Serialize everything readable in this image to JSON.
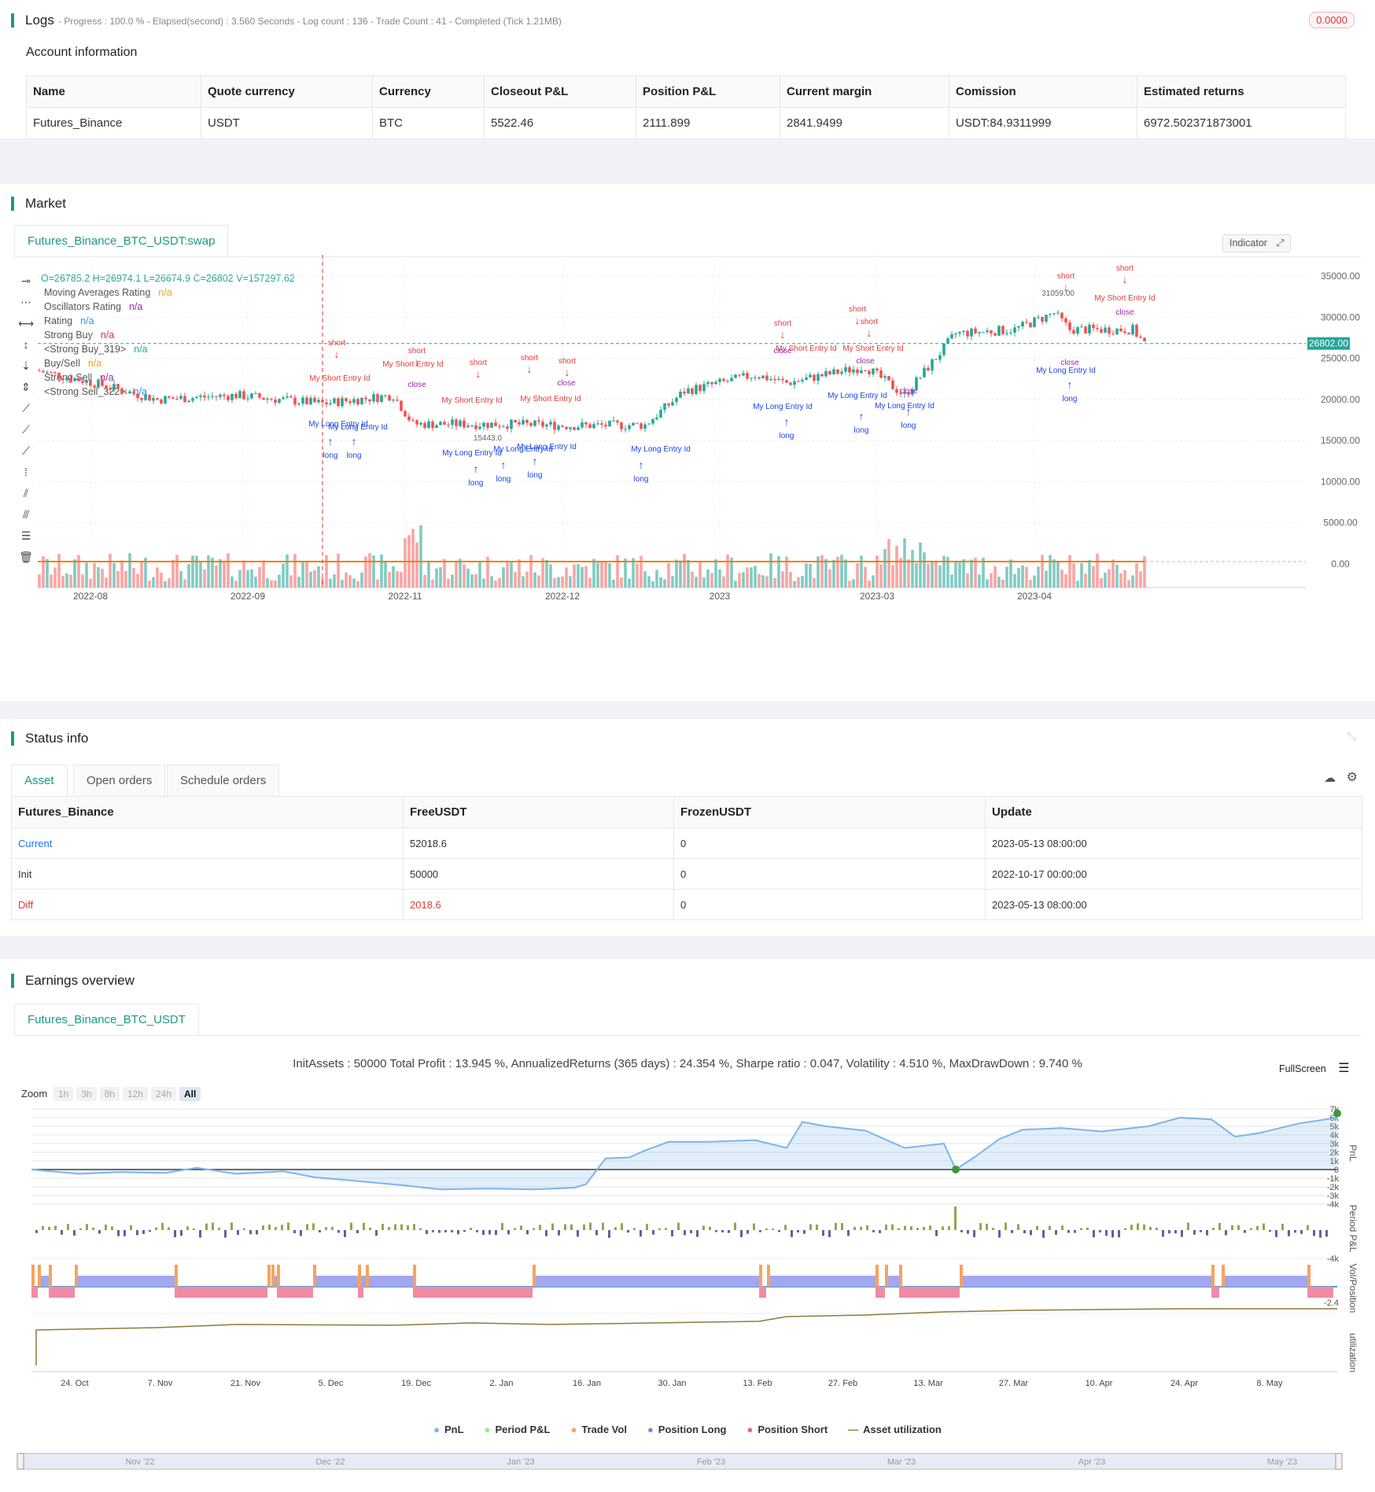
{
  "logs": {
    "title": "Logs",
    "status": "- Progress : 100.0 % - Elapsed(second) : 3.560  Seconds - Log count : 136 - Trade Count : 41 - Completed (Tick 1.21MB)",
    "badge": "0.0000",
    "account_title": "Account information",
    "columns": [
      "Name",
      "Quote currency",
      "Currency",
      "Closeout P&L",
      "Position P&L",
      "Current margin",
      "Comission",
      "Estimated returns"
    ],
    "row": [
      "Futures_Binance",
      "USDT",
      "BTC",
      "5522.46",
      "2111.899",
      "2841.9499",
      "USDT:84.9311999",
      "6972.502371873001"
    ]
  },
  "market": {
    "title": "Market",
    "tab": "Futures_Binance_BTC_USDT:swap",
    "ohlc": "O=26785.2  H=26974.1  L=26674.9  C=26802  V=157297.62",
    "indicator_btn": "Indicator",
    "legend": [
      {
        "label": "Moving Averages Rating",
        "value": "n/a",
        "color": "#f4a21c"
      },
      {
        "label": "Oscillators Rating",
        "value": "n/a",
        "color": "#9c27b0"
      },
      {
        "label": "Rating",
        "value": "n/a",
        "color": "#2196f3"
      },
      {
        "label": "Strong Buy",
        "value": "n/a",
        "color": "#e91e63"
      },
      {
        "label": "<Strong Buy_319>",
        "value": "n/a",
        "color": "#26a69a"
      },
      {
        "label": "Buy/Sell",
        "value": "n/a",
        "color": "#f4a21c"
      },
      {
        "label": "Strong Sell",
        "value": "n/a",
        "color": "#9c27b0"
      },
      {
        "label": "<Strong Sell_322>",
        "value": "n/a",
        "color": "#2196f3"
      }
    ],
    "price_ticks": [
      "35000.00",
      "30000.00",
      "25000.00",
      "20000.00",
      "15000.00",
      "10000.00",
      "5000.00",
      "0.00"
    ],
    "last_price": "26802.00",
    "x_ticks": [
      "2022-08",
      "2022-09",
      "2022-11",
      "2022-12",
      "2023",
      "2023-03",
      "2023-04"
    ],
    "annotations": {
      "short": "short",
      "long": "long",
      "close": "close",
      "short_entry": "My Short Entry Id",
      "long_entry": "My Long Entry Id",
      "one": "1",
      "price_a": "31059.00",
      "price_b": "15443.0"
    }
  },
  "status": {
    "title": "Status info",
    "tabs": [
      "Asset",
      "Open orders",
      "Schedule orders"
    ],
    "columns": [
      "Futures_Binance",
      "FreeUSDT",
      "FrozenUSDT",
      "Update"
    ],
    "rows": [
      [
        "Current",
        "52018.6",
        "0",
        "2023-05-13 08:00:00"
      ],
      [
        "Init",
        "50000",
        "0",
        "2022-10-17 00:00:00"
      ],
      [
        "Diff",
        "2018.6",
        "0",
        "2023-05-13 08:00:00"
      ]
    ]
  },
  "earnings": {
    "title": "Earnings overview",
    "tab": "Futures_Binance_BTC_USDT",
    "summary": "InitAssets : 50000 Total Profit : 13.945 %, AnnualizedReturns (365 days) : 24.354 %, Sharpe ratio : 0.047, Volatility : 4.510 %, MaxDrawDown : 9.740 %",
    "fullscreen": "FullScreen",
    "zoom_label": "Zoom",
    "zoom_options": [
      "1h",
      "3h",
      "8h",
      "12h",
      "24h",
      "All"
    ],
    "pnl_ticks": [
      "7k",
      "6k",
      "5k",
      "4k",
      "3k",
      "2k",
      "1k",
      "0",
      "-1k",
      "-2k",
      "-3k",
      "-4k"
    ],
    "axis_titles": [
      "PnL",
      "Period P&L",
      "Vol/Position",
      "utilization"
    ],
    "period_tick": "-4k",
    "vol_tick": "-2.4",
    "x_ticks": [
      "24. Oct",
      "7. Nov",
      "21. Nov",
      "5. Dec",
      "19. Dec",
      "2. Jan",
      "16. Jan",
      "30. Jan",
      "13. Feb",
      "27. Feb",
      "13. Mar",
      "27. Mar",
      "10. Apr",
      "24. Apr",
      "8. May"
    ],
    "legend": [
      {
        "label": "PnL",
        "color": "#7cb5ec"
      },
      {
        "label": "Period P&L",
        "color": "#90ed7d"
      },
      {
        "label": "Trade Vol",
        "color": "#f7a35c"
      },
      {
        "label": "Position Long",
        "color": "#8085e9"
      },
      {
        "label": "Position Short",
        "color": "#f15c80"
      },
      {
        "label": "Asset utilization",
        "color": "#8d7a3a"
      }
    ],
    "navigator": [
      "Nov '22",
      "Dec '22",
      "Jan '23",
      "Feb '23",
      "Mar '23",
      "Apr '23",
      "May '23"
    ]
  },
  "colors": {
    "accent": "#1a9c7a",
    "up": "#26a69a",
    "down": "#ef5350",
    "diff": "#e53935",
    "link": "#1a73e8"
  }
}
